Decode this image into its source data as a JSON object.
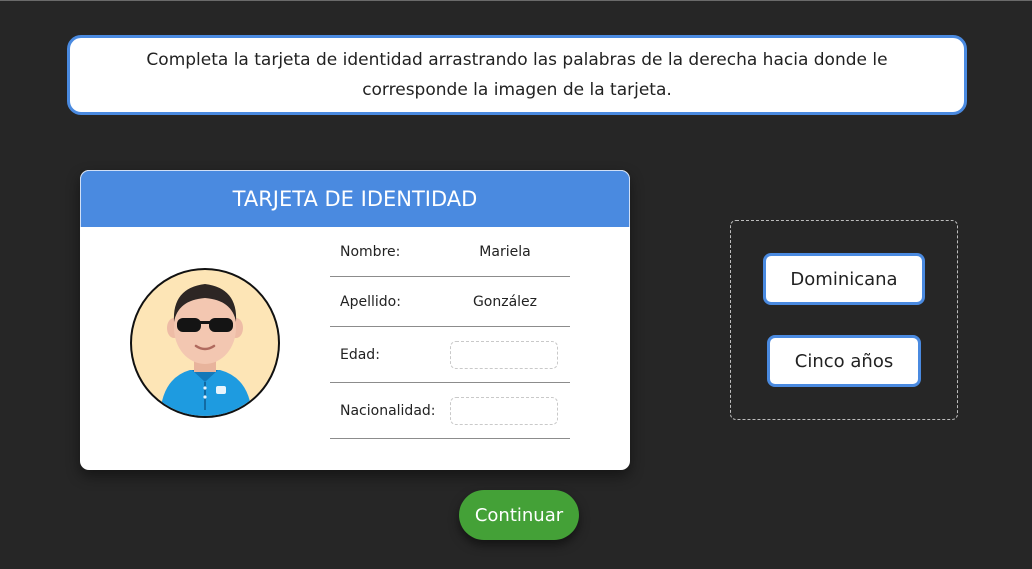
{
  "instructions": {
    "text": "Completa la tarjeta de identidad arrastrando las palabras de la derecha hacia donde le corresponde la imagen de la tarjeta."
  },
  "card": {
    "title": "TARJETA DE IDENTIDAD",
    "avatar_icon": "person-avatar-icon",
    "fields": [
      {
        "label": "Nombre:",
        "value": "Mariela"
      },
      {
        "label": "Apellido:",
        "value": "González"
      },
      {
        "label": "Edad:",
        "value": ""
      },
      {
        "label": "Nacionalidad:",
        "value": ""
      }
    ]
  },
  "word_bank": {
    "words": [
      "Dominicana",
      "Cinco años"
    ]
  },
  "continue_button": {
    "label": "Continuar"
  },
  "colors": {
    "background": "#262626",
    "accent_blue": "#4a8ae0",
    "button_green": "#44a137",
    "avatar_bg": "#fde5b6"
  }
}
